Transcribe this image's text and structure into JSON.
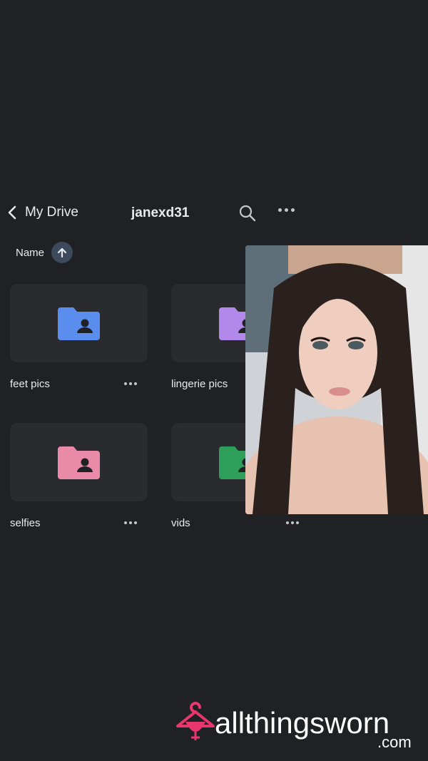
{
  "header": {
    "back_label": "My Drive",
    "title": "janexd31"
  },
  "sort": {
    "label": "Name",
    "direction": "ascending"
  },
  "folders": [
    {
      "name": "feet pics",
      "color": "#5b8def"
    },
    {
      "name": "lingerie pics",
      "color": "#b388eb"
    },
    {
      "name": "selfies",
      "color": "#e88aa8"
    },
    {
      "name": "vids",
      "color": "#2e9e5b"
    }
  ],
  "watermark": {
    "brand": "allthingsworn",
    "suffix": ".com",
    "color": "#e8366e"
  },
  "icons": [
    "chevron-left-icon",
    "search-icon",
    "more-horizontal-icon",
    "arrow-up-icon",
    "shared-folder-icon",
    "hanger-icon"
  ]
}
